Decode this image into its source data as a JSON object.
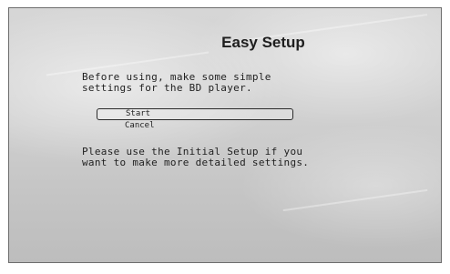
{
  "dialog": {
    "title": "Easy Setup",
    "intro_lines": [
      "Before using, make some simple",
      "settings for the BD player."
    ],
    "menu": [
      {
        "label": "Start",
        "selected": true
      },
      {
        "label": "Cancel",
        "selected": false
      }
    ],
    "hint_lines": [
      "Please use the Initial Setup if you",
      "want to make more detailed settings."
    ]
  },
  "colors": {
    "text": "#1f1f1f",
    "background": "#cfcfcf",
    "frame_border": "#6d6d6d",
    "selection_border": "#2b2b2b"
  }
}
